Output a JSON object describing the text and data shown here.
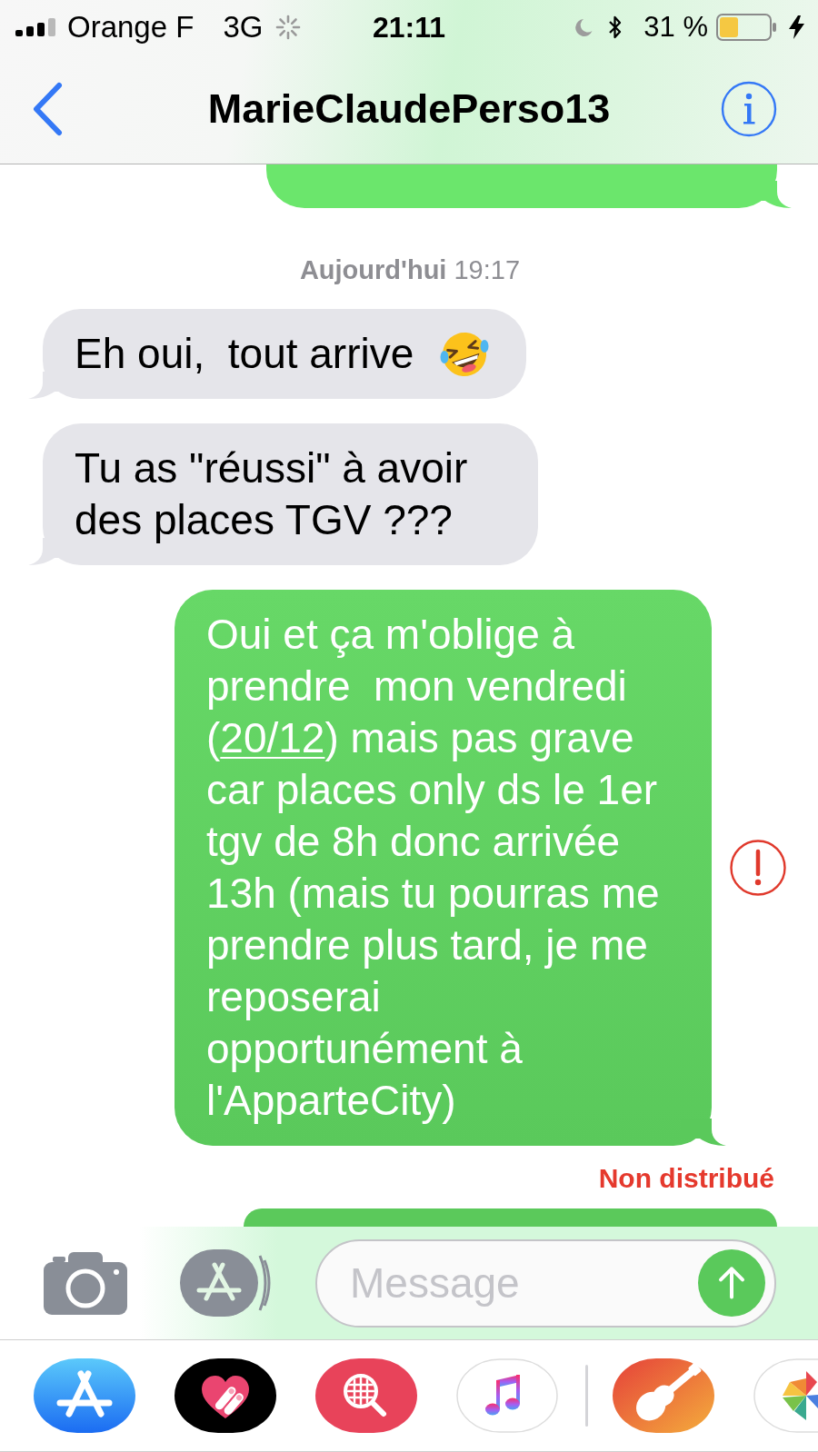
{
  "status_bar": {
    "carrier": "Orange F",
    "network": "3G",
    "time": "21:11",
    "battery": "31 %"
  },
  "header": {
    "title": "MarieClaudePerso13"
  },
  "thread": {
    "earlier_bubble": {
      "kind": "sent"
    },
    "timestamp": "**Aujourd'hui** 19:17",
    "messages": [
      {
        "kind": "received",
        "segments": [
          {
            "kind": "text",
            "text": "Eh oui,  tout arrive"
          }
        ],
        "emoji": true,
        "failed": false
      },
      {
        "kind": "received",
        "segments": [
          {
            "kind": "text",
            "text": "Tu as \"réussi\" à avoir des places TGV ???"
          }
        ],
        "emoji": false,
        "failed": false
      },
      {
        "kind": "sent",
        "segments": [
          {
            "kind": "text",
            "text": "Oui et ça m'oblige à prendre  mon vendredi ("
          },
          {
            "kind": "link",
            "text": "20/12"
          },
          {
            "kind": "text",
            "text": ") mais pas grave car places only ds le 1er tgv de 8h donc arrivée 13h (mais tu pourras me prendre plus tard, je me reposerai opportunément à l'ApparteCity)"
          }
        ],
        "emoji": false,
        "failed": true,
        "status": "Non distribué"
      }
    ],
    "later_bubble": {
      "kind": "sent"
    }
  },
  "composer": {
    "placeholder": "Message"
  }
}
